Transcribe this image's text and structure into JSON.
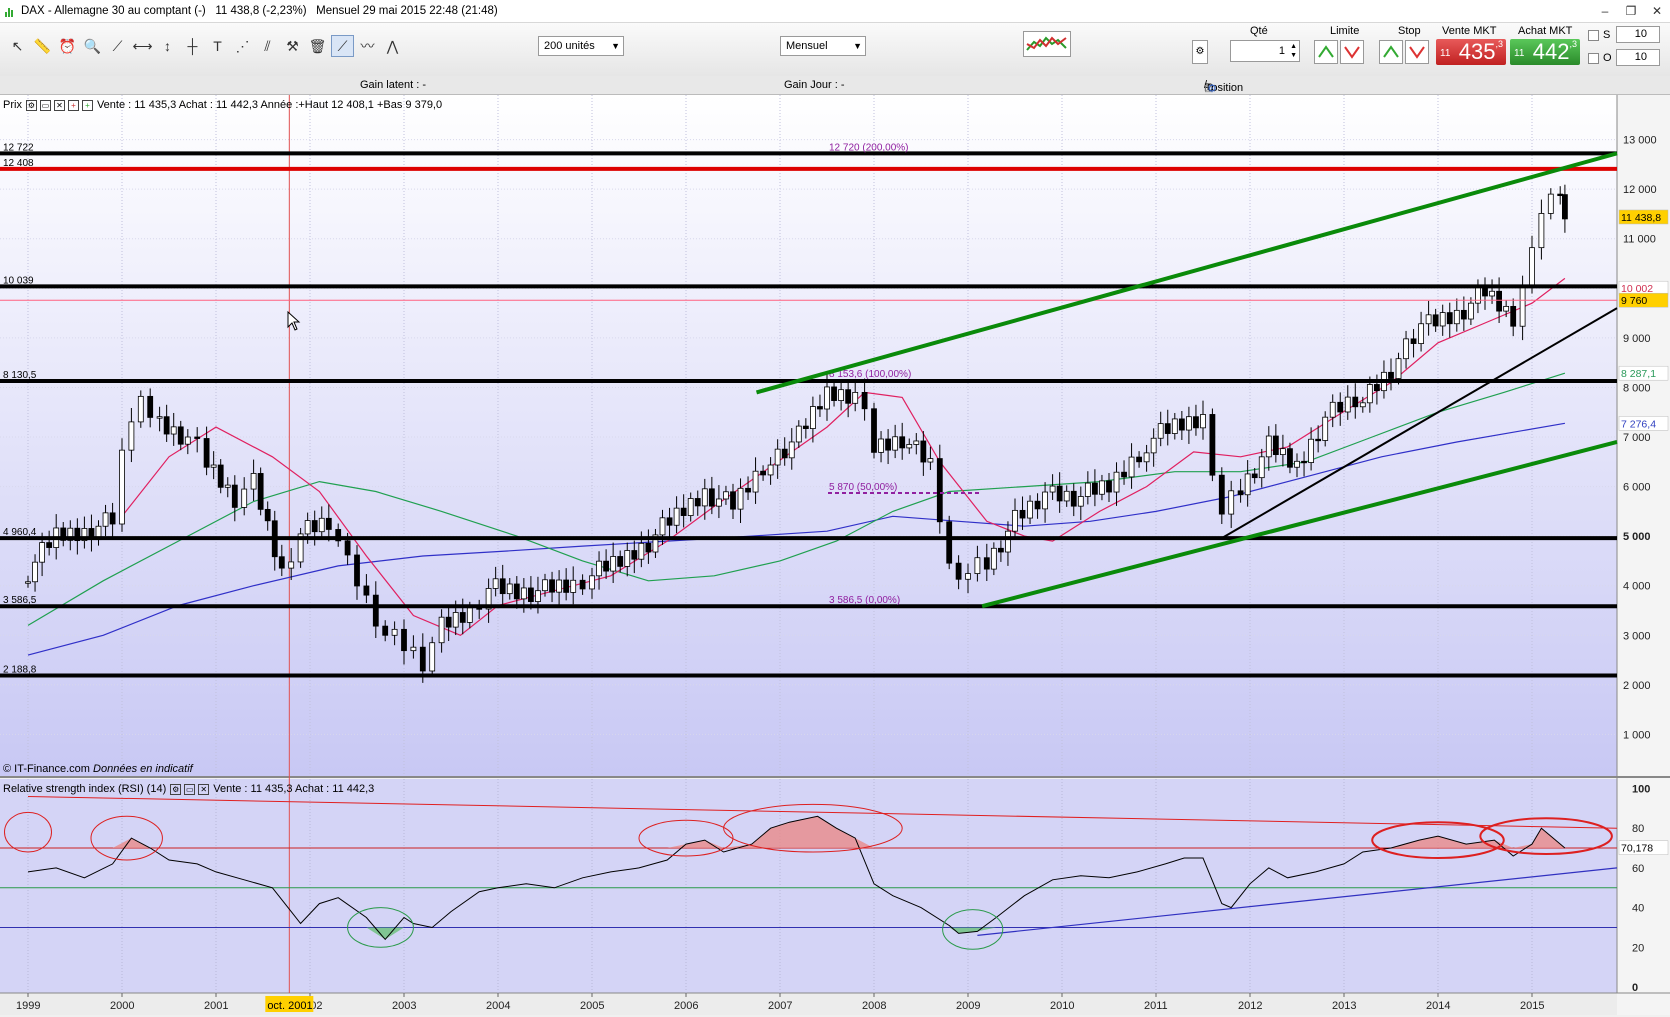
{
  "window": {
    "title": "DAX - Allemagne 30 au comptant (-)",
    "price": "11 438,8 (-2,23%)",
    "period": "Mensuel",
    "datetime": "29 mai 2015 22:48 (21:48)"
  },
  "toolbar": {
    "units_select": "200 unités",
    "period_select": "Mensuel",
    "tools": [
      "pointer-icon",
      "ruler-icon",
      "alarm-icon",
      "zoom-icon",
      "segment-icon",
      "horizontal-line-icon",
      "vertical-line-icon",
      "text-icon",
      "fibonacci-icon",
      "channel-icon",
      "pitchfork-icon",
      "trash-icon",
      "trendline-icon",
      "wave-icon",
      "pattern-icon"
    ]
  },
  "order": {
    "qty_label": "Qté",
    "qty_value": "1",
    "limit_label": "Limite",
    "stop_label": "Stop",
    "sell_label": "Vente MKT",
    "sell_small": "11",
    "sell_big": "435",
    "sell_tail": ",3",
    "buy_label": "Achat MKT",
    "buy_small": "11",
    "buy_big": "442",
    "buy_tail": ",3",
    "s_label": "S",
    "s_value": "10",
    "o_label": "O",
    "o_value": "10",
    "sell_color": "#d03030",
    "buy_color": "#3aa03a"
  },
  "infobar": {
    "gain_latent": "Gain latent : -",
    "gain_jour": "Gain Jour : -",
    "position": "Position : 0",
    "position_tail": "0"
  },
  "price_panel": {
    "label": "Prix",
    "quote": "Vente : 11 435,3 Achat : 11 442,3 Année :+Haut 12 408,1 +Bas 9 379,0",
    "credit": "© IT-Finance.com",
    "credit_note": "Données en indicatif"
  },
  "rsi_panel": {
    "label": "Relative strength index (RSI) (14)",
    "quote": "Vente : 11 435,3 Achat : 11 442,3",
    "last_value": "70,178"
  },
  "time_axis": {
    "years": [
      "1999",
      "2000",
      "2001",
      "2002",
      "2003",
      "2004",
      "2005",
      "2006",
      "2007",
      "2008",
      "2009",
      "2010",
      "2011",
      "2012",
      "2013",
      "2014",
      "2015"
    ],
    "cursor_label": "oct. 2001"
  },
  "chart_data": {
    "type": "candlestick",
    "ylim": [
      0,
      14500
    ],
    "price_ticks": [
      "1 000",
      "2 000",
      "3 000",
      "4 000",
      "5 000",
      "6 000",
      "7 000",
      "8 000",
      "9 000",
      "10 000",
      "11 000",
      "12 000",
      "13 000",
      "14 000"
    ],
    "bold_ticks": [
      "5 000"
    ],
    "levels": [
      {
        "label": "12 722",
        "value": 12722,
        "color": "#000000"
      },
      {
        "label": "12 408",
        "value": 12408,
        "color": "#dd0000"
      },
      {
        "label": "10 039",
        "value": 10039,
        "color": "#000000"
      },
      {
        "label": "8 130,5",
        "value": 8130.5,
        "color": "#000000"
      },
      {
        "label": "4 960,4",
        "value": 4960.4,
        "color": "#000000"
      },
      {
        "label": "3 586,5",
        "value": 3586.5,
        "color": "#000000"
      },
      {
        "label": "2 188,8",
        "value": 2188.8,
        "color": "#000000"
      }
    ],
    "fib_labels": [
      {
        "text": "12 720 (200,00%)",
        "value": 12720
      },
      {
        "text": "8 153,6 (100,00%)",
        "value": 8153.6
      },
      {
        "text": "5 870 (50,00%)",
        "value": 5870
      },
      {
        "text": "3 586,5 (0,00%)",
        "value": 3586.5
      }
    ],
    "axis_markers": [
      {
        "text": "11 438,8",
        "value": 11438.8,
        "bg": "#ffd000",
        "fg": "#000000"
      },
      {
        "text": "10 002",
        "value": 10002,
        "bg": "#ffffff",
        "fg": "#d03050"
      },
      {
        "text": "9 760",
        "value": 9760,
        "bg": "#ffd000",
        "fg": "#000000"
      },
      {
        "text": "8 287,1",
        "value": 8287.1,
        "bg": "#ffffff",
        "fg": "#2a9a5a"
      },
      {
        "text": "7 276,4",
        "value": 7276.4,
        "bg": "#ffffff",
        "fg": "#3040c0"
      }
    ],
    "close_path": [
      [
        1999.0,
        4300
      ],
      [
        1999.3,
        5000
      ],
      [
        1999.6,
        5100
      ],
      [
        1999.9,
        5300
      ],
      [
        2000.0,
        6900
      ],
      [
        2000.2,
        7600
      ],
      [
        2000.4,
        7300
      ],
      [
        2000.7,
        7000
      ],
      [
        2000.9,
        6500
      ],
      [
        2001.2,
        5800
      ],
      [
        2001.4,
        6100
      ],
      [
        2001.7,
        4300
      ],
      [
        2001.9,
        5100
      ],
      [
        2002.2,
        5300
      ],
      [
        2002.4,
        4400
      ],
      [
        2002.6,
        3700
      ],
      [
        2002.8,
        3000
      ],
      [
        2003.0,
        2800
      ],
      [
        2003.2,
        2500
      ],
      [
        2003.4,
        3200
      ],
      [
        2003.7,
        3500
      ],
      [
        2003.9,
        4000
      ],
      [
        2004.2,
        3900
      ],
      [
        2004.5,
        3900
      ],
      [
        2004.8,
        4000
      ],
      [
        2005.0,
        4200
      ],
      [
        2005.3,
        4500
      ],
      [
        2005.6,
        4900
      ],
      [
        2005.9,
        5400
      ],
      [
        2006.2,
        5900
      ],
      [
        2006.5,
        5600
      ],
      [
        2006.9,
        6600
      ],
      [
        2007.2,
        7000
      ],
      [
        2007.5,
        7900
      ],
      [
        2007.8,
        7900
      ],
      [
        2008.0,
        6800
      ],
      [
        2008.3,
        7000
      ],
      [
        2008.6,
        6400
      ],
      [
        2008.8,
        4400
      ],
      [
        2009.0,
        4300
      ],
      [
        2009.2,
        4500
      ],
      [
        2009.5,
        5300
      ],
      [
        2009.9,
        5900
      ],
      [
        2010.2,
        5800
      ],
      [
        2010.5,
        6000
      ],
      [
        2010.9,
        6900
      ],
      [
        2011.2,
        7200
      ],
      [
        2011.5,
        7400
      ],
      [
        2011.7,
        5500
      ],
      [
        2011.9,
        6000
      ],
      [
        2012.2,
        6800
      ],
      [
        2012.5,
        6400
      ],
      [
        2012.8,
        7400
      ],
      [
        2013.2,
        7800
      ],
      [
        2013.5,
        8400
      ],
      [
        2013.9,
        9300
      ],
      [
        2014.2,
        9500
      ],
      [
        2014.5,
        9900
      ],
      [
        2014.8,
        9400
      ],
      [
        2015.0,
        10600
      ],
      [
        2015.1,
        11400
      ],
      [
        2015.2,
        11900
      ],
      [
        2015.3,
        12000
      ],
      [
        2015.35,
        11400
      ]
    ],
    "ma_red": [
      [
        2000.0,
        5400
      ],
      [
        2000.5,
        6600
      ],
      [
        2001.0,
        7200
      ],
      [
        2001.6,
        6600
      ],
      [
        2002.1,
        5900
      ],
      [
        2002.6,
        4600
      ],
      [
        2003.1,
        3400
      ],
      [
        2003.6,
        3000
      ],
      [
        2004.0,
        3600
      ],
      [
        2004.6,
        3900
      ],
      [
        2005.2,
        4200
      ],
      [
        2005.8,
        4900
      ],
      [
        2006.3,
        5600
      ],
      [
        2006.9,
        6400
      ],
      [
        2007.5,
        7200
      ],
      [
        2007.9,
        7900
      ],
      [
        2008.3,
        7800
      ],
      [
        2008.7,
        6500
      ],
      [
        2009.2,
        5300
      ],
      [
        2009.6,
        5000
      ],
      [
        2009.9,
        4900
      ],
      [
        2010.4,
        5500
      ],
      [
        2010.9,
        6000
      ],
      [
        2011.4,
        6700
      ],
      [
        2011.9,
        6600
      ],
      [
        2012.4,
        6800
      ],
      [
        2012.9,
        7400
      ],
      [
        2013.5,
        8100
      ],
      [
        2014.0,
        8900
      ],
      [
        2014.5,
        9300
      ],
      [
        2015.0,
        9700
      ],
      [
        2015.35,
        10200
      ]
    ],
    "ma_green": [
      [
        1999.0,
        3200
      ],
      [
        1999.8,
        4100
      ],
      [
        2000.6,
        4900
      ],
      [
        2001.4,
        5700
      ],
      [
        2002.1,
        6100
      ],
      [
        2002.7,
        5900
      ],
      [
        2003.4,
        5500
      ],
      [
        2004.2,
        5000
      ],
      [
        2004.9,
        4500
      ],
      [
        2005.6,
        4100
      ],
      [
        2006.3,
        4200
      ],
      [
        2007.0,
        4500
      ],
      [
        2007.6,
        4900
      ],
      [
        2008.2,
        5500
      ],
      [
        2008.8,
        5900
      ],
      [
        2009.6,
        6000
      ],
      [
        2010.4,
        6100
      ],
      [
        2011.2,
        6300
      ],
      [
        2011.9,
        6300
      ],
      [
        2012.6,
        6500
      ],
      [
        2013.3,
        7000
      ],
      [
        2014.0,
        7500
      ],
      [
        2014.7,
        7900
      ],
      [
        2015.35,
        8287
      ]
    ],
    "ma_blue": [
      [
        1999.0,
        2600
      ],
      [
        1999.8,
        3000
      ],
      [
        2000.6,
        3600
      ],
      [
        2001.4,
        4000
      ],
      [
        2002.3,
        4400
      ],
      [
        2003.2,
        4600
      ],
      [
        2004.1,
        4700
      ],
      [
        2004.9,
        4800
      ],
      [
        2005.8,
        4900
      ],
      [
        2006.7,
        5000
      ],
      [
        2007.5,
        5100
      ],
      [
        2008.2,
        5400
      ],
      [
        2008.9,
        5300
      ],
      [
        2009.6,
        5200
      ],
      [
        2010.3,
        5300
      ],
      [
        2011.0,
        5500
      ],
      [
        2011.8,
        5800
      ],
      [
        2012.6,
        6200
      ],
      [
        2013.4,
        6600
      ],
      [
        2014.2,
        6900
      ],
      [
        2015.35,
        7276
      ]
    ],
    "trendlines": [
      {
        "color": "#0a8a0a",
        "width": 4,
        "from": [
          2006.75,
          7900
        ],
        "to": [
          2015.95,
          12722
        ]
      },
      {
        "color": "#0a8a0a",
        "width": 4,
        "from": [
          2009.15,
          3586
        ],
        "to": [
          2015.95,
          6900
        ]
      },
      {
        "color": "#000000",
        "width": 2,
        "from": [
          2011.7,
          4960
        ],
        "to": [
          2015.95,
          9600
        ]
      }
    ],
    "rsi": {
      "ylim": [
        0,
        100
      ],
      "ticks": [
        "0",
        "20",
        "40",
        "60",
        "80",
        "100"
      ],
      "levels": [
        {
          "value": 70,
          "color": "#cc2020"
        },
        {
          "value": 50,
          "color": "#2a9a4a"
        },
        {
          "value": 30,
          "color": "#3030b0"
        }
      ],
      "values": [
        [
          1999.0,
          58
        ],
        [
          1999.3,
          60
        ],
        [
          1999.6,
          55
        ],
        [
          1999.9,
          62
        ],
        [
          2000.1,
          75
        ],
        [
          2000.3,
          70
        ],
        [
          2000.5,
          64
        ],
        [
          2000.8,
          62
        ],
        [
          2001.0,
          58
        ],
        [
          2001.3,
          54
        ],
        [
          2001.6,
          50
        ],
        [
          2001.8,
          38
        ],
        [
          2001.9,
          32
        ],
        [
          2002.1,
          42
        ],
        [
          2002.3,
          45
        ],
        [
          2002.6,
          35
        ],
        [
          2002.8,
          24
        ],
        [
          2003.0,
          35
        ],
        [
          2003.1,
          32
        ],
        [
          2003.3,
          30
        ],
        [
          2003.5,
          38
        ],
        [
          2003.8,
          48
        ],
        [
          2004.0,
          50
        ],
        [
          2004.3,
          52
        ],
        [
          2004.6,
          50
        ],
        [
          2004.9,
          55
        ],
        [
          2005.2,
          58
        ],
        [
          2005.5,
          60
        ],
        [
          2005.8,
          64
        ],
        [
          2006.0,
          72
        ],
        [
          2006.2,
          74
        ],
        [
          2006.4,
          68
        ],
        [
          2006.7,
          72
        ],
        [
          2006.9,
          80
        ],
        [
          2007.1,
          83
        ],
        [
          2007.4,
          86
        ],
        [
          2007.6,
          80
        ],
        [
          2007.8,
          75
        ],
        [
          2008.0,
          52
        ],
        [
          2008.2,
          46
        ],
        [
          2008.5,
          40
        ],
        [
          2008.8,
          31
        ],
        [
          2008.9,
          27
        ],
        [
          2009.1,
          28
        ],
        [
          2009.3,
          35
        ],
        [
          2009.6,
          46
        ],
        [
          2009.9,
          54
        ],
        [
          2010.2,
          56
        ],
        [
          2010.5,
          55
        ],
        [
          2010.8,
          58
        ],
        [
          2011.1,
          62
        ],
        [
          2011.3,
          65
        ],
        [
          2011.5,
          65
        ],
        [
          2011.7,
          42
        ],
        [
          2011.8,
          40
        ],
        [
          2012.0,
          52
        ],
        [
          2012.2,
          60
        ],
        [
          2012.4,
          55
        ],
        [
          2012.7,
          58
        ],
        [
          2013.0,
          62
        ],
        [
          2013.2,
          68
        ],
        [
          2013.5,
          70
        ],
        [
          2013.8,
          74
        ],
        [
          2014.0,
          76
        ],
        [
          2014.3,
          72
        ],
        [
          2014.6,
          74
        ],
        [
          2014.8,
          66
        ],
        [
          2015.0,
          72
        ],
        [
          2015.1,
          80
        ],
        [
          2015.2,
          76
        ],
        [
          2015.35,
          70
        ]
      ],
      "trend_red": {
        "from": [
          1999.0,
          96
        ],
        "to": [
          2015.95,
          80
        ]
      },
      "trend_blue": {
        "from": [
          2009.1,
          26
        ],
        "to": [
          2015.95,
          60
        ]
      },
      "circles": [
        {
          "cx": 1999.0,
          "cy": 78,
          "rx": 0.25,
          "ry": 10,
          "color": "#dd2020",
          "width": 1
        },
        {
          "cx": 2000.05,
          "cy": 75,
          "rx": 0.38,
          "ry": 11,
          "color": "#dd2020",
          "width": 1
        },
        {
          "cx": 2006.0,
          "cy": 75,
          "rx": 0.5,
          "ry": 9,
          "color": "#dd2020",
          "width": 1
        },
        {
          "cx": 2007.35,
          "cy": 80,
          "rx": 0.95,
          "ry": 12,
          "color": "#dd2020",
          "width": 1
        },
        {
          "cx": 2014.0,
          "cy": 74,
          "rx": 0.7,
          "ry": 9,
          "color": "#dd2020",
          "width": 2
        },
        {
          "cx": 2015.15,
          "cy": 76,
          "rx": 0.7,
          "ry": 9,
          "color": "#dd2020",
          "width": 2
        },
        {
          "cx": 2002.75,
          "cy": 30,
          "rx": 0.35,
          "ry": 10,
          "color": "#2a9a4a",
          "width": 1
        },
        {
          "cx": 2009.05,
          "cy": 29,
          "rx": 0.32,
          "ry": 10,
          "color": "#2a9a4a",
          "width": 1
        }
      ]
    }
  }
}
